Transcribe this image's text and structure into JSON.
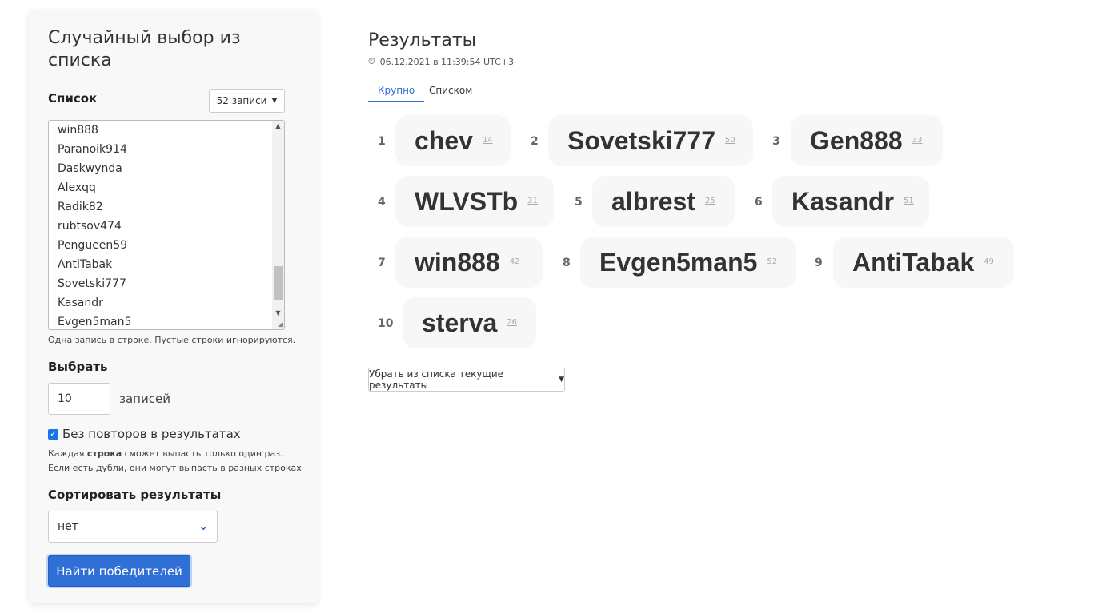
{
  "panel": {
    "title": "Случайный выбор из списка",
    "list_label": "Список",
    "count_button": "52 записи",
    "list_items": [
      "win888",
      "Paranoik914",
      "Daskwynda",
      "Alexqq",
      "Radik82",
      "rubtsov474",
      "Pengueen59",
      "AntiTabak",
      "Sovetski777",
      "Kasandr",
      "Evgen5man5"
    ],
    "list_hint": "Одна запись в строке. Пустые строки игнорируются.",
    "choose_label": "Выбрать",
    "choose_value": "10",
    "choose_unit": "записей",
    "no_repeat_label": "Без повторов в результатах",
    "no_repeat_checked": true,
    "no_repeat_hint_prefix": "Каждая ",
    "no_repeat_hint_bold": "строка",
    "no_repeat_hint_suffix": " сможет выпасть только один раз.",
    "no_repeat_hint_line2": "Если есть дубли, они могут выпасть в разных строках",
    "sort_label": "Сортировать результаты",
    "sort_value": "нет",
    "find_button": "Найти победителей"
  },
  "results": {
    "title": "Результаты",
    "timestamp": "06.12.2021 в 11:39:54 UTC+3",
    "tabs": [
      {
        "label": "Крупно",
        "active": true
      },
      {
        "label": "Списком",
        "active": false
      }
    ],
    "winners": [
      {
        "rank": "1",
        "name": "chev",
        "index": "14"
      },
      {
        "rank": "2",
        "name": "Sovetski777",
        "index": "50"
      },
      {
        "rank": "3",
        "name": "Gen888",
        "index": "33"
      },
      {
        "rank": "4",
        "name": "WLVSTb",
        "index": "31"
      },
      {
        "rank": "5",
        "name": "albrest",
        "index": "25"
      },
      {
        "rank": "6",
        "name": "Kasandr",
        "index": "51"
      },
      {
        "rank": "7",
        "name": "win888",
        "index": "42"
      },
      {
        "rank": "8",
        "name": "Evgen5man5",
        "index": "52"
      },
      {
        "rank": "9",
        "name": "AntiTabak",
        "index": "49"
      },
      {
        "rank": "10",
        "name": "sterva",
        "index": "26"
      }
    ],
    "remove_button": "Убрать из списка текущие результаты"
  },
  "colors": {
    "accent": "#2f6fd6",
    "card": "#f7f7f7"
  },
  "icons": {
    "timer": "stopwatch-icon",
    "dropdown": "chevron-down-icon"
  }
}
